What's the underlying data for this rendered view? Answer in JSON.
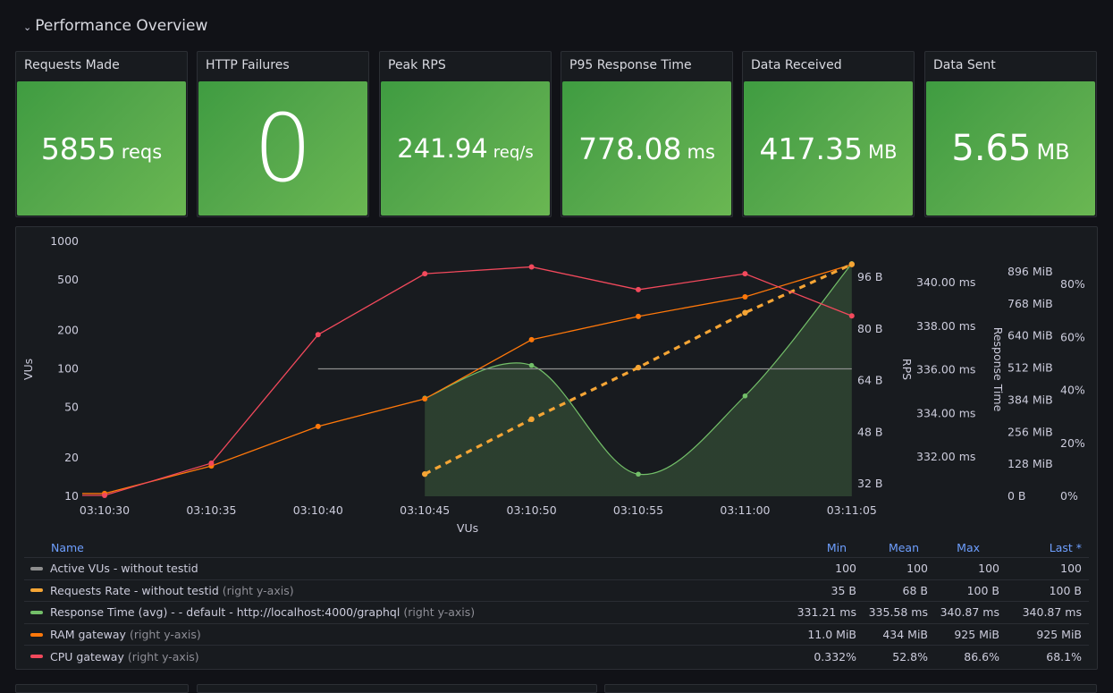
{
  "row": {
    "title": "Performance Overview",
    "collapse_icon": "chevron-down-icon"
  },
  "stats": [
    {
      "title": "Requests Made",
      "value": "5855",
      "unit": "reqs"
    },
    {
      "title": "HTTP Failures",
      "value": "0",
      "unit": ""
    },
    {
      "title": "Peak RPS",
      "value": "241.94",
      "unit": "req/s"
    },
    {
      "title": "P95 Response Time",
      "value": "778.08",
      "unit": "ms"
    },
    {
      "title": "Data Received",
      "value": "417.35",
      "unit": "MB"
    },
    {
      "title": "Data Sent",
      "value": "5.65",
      "unit": "MB"
    }
  ],
  "colors": {
    "stat_green": "#56a84c",
    "vus": "#8e8e8e",
    "requests_rate": "#f5a535",
    "response_time": "#73bf69",
    "ram": "#ff780a",
    "cpu": "#f2495c",
    "legend_header": "#6e9fff"
  },
  "chart_data": {
    "type": "line",
    "x": [
      "03:10:30",
      "03:10:35",
      "03:10:40",
      "03:10:45",
      "03:10:50",
      "03:10:55",
      "03:11:00",
      "03:11:05"
    ],
    "xlabel": "VUs",
    "axes": {
      "left": {
        "label": "VUs",
        "scale": "log",
        "ticks": [
          "1000",
          "500",
          "200",
          "100",
          "50",
          "20",
          "10"
        ],
        "tick_values": [
          1000,
          500,
          200,
          100,
          50,
          20,
          10
        ],
        "range": [
          10,
          1000
        ]
      },
      "rps": {
        "label": "RPS",
        "ticks": [
          "96 B",
          "80 B",
          "64 B",
          "48 B",
          "32 B"
        ],
        "tick_values": [
          96,
          80,
          64,
          48,
          32
        ],
        "range": [
          29.5,
          101
        ]
      },
      "response": {
        "label": "Response Time",
        "ticks": [
          "340.00 ms",
          "338.00 ms",
          "336.00 ms",
          "334.00 ms",
          "332.00 ms"
        ],
        "tick_values": [
          340,
          338,
          336,
          334,
          332
        ],
        "range": [
          330.2,
          341.2
        ]
      },
      "ram": {
        "label": "",
        "ticks": [
          "896 MiB",
          "768 MiB",
          "640 MiB",
          "512 MiB",
          "384 MiB",
          "256 MiB",
          "128 MiB",
          "0 B"
        ],
        "tick_values": [
          896,
          768,
          640,
          512,
          384,
          256,
          128,
          0
        ],
        "range": [
          0,
          940
        ]
      },
      "cpu": {
        "label": "",
        "ticks": [
          "80%",
          "60%",
          "40%",
          "20%",
          "0%"
        ],
        "tick_values": [
          80,
          60,
          40,
          20,
          0
        ],
        "range": [
          0,
          88
        ]
      }
    },
    "series": [
      {
        "name": "Active VUs - without testid",
        "axis": "left",
        "style": "line",
        "values": [
          null,
          null,
          100,
          100,
          100,
          100,
          100,
          100
        ]
      },
      {
        "name": "Requests Rate - without testid",
        "axis": "rps",
        "style": "dashed",
        "values": [
          null,
          null,
          null,
          35,
          52,
          68,
          85,
          100
        ]
      },
      {
        "name": "Response Time (avg) - - default - http://localhost:4000/graphql",
        "axis": "response",
        "style": "area-smooth",
        "values": [
          null,
          null,
          null,
          334.7,
          336.2,
          331.21,
          334.8,
          340.87
        ]
      },
      {
        "name": "RAM gateway",
        "axis": "ram",
        "style": "line-points",
        "values": [
          11,
          121,
          279,
          389,
          625,
          718,
          796,
          925
        ]
      },
      {
        "name": "CPU gateway",
        "axis": "cpu",
        "style": "line-points",
        "values": [
          0.332,
          12.5,
          61,
          84,
          86.6,
          78,
          84,
          68.1
        ]
      }
    ]
  },
  "legend": {
    "headers": {
      "name": "Name",
      "min": "Min",
      "mean": "Mean",
      "max": "Max",
      "last": "Last *"
    },
    "rows": [
      {
        "name": "Active VUs - without testid",
        "axis_note": "",
        "color": "#8e8e8e",
        "min": "100",
        "mean": "100",
        "max": "100",
        "last": "100"
      },
      {
        "name": "Requests Rate - without testid",
        "axis_note": "(right y-axis)",
        "color": "#f5a535",
        "min": "35 B",
        "mean": "68 B",
        "max": "100 B",
        "last": "100 B"
      },
      {
        "name": "Response Time (avg) - - default - http://localhost:4000/graphql",
        "axis_note": "(right y-axis)",
        "color": "#73bf69",
        "min": "331.21 ms",
        "mean": "335.58 ms",
        "max": "340.87 ms",
        "last": "340.87 ms"
      },
      {
        "name": "RAM gateway",
        "axis_note": "(right y-axis)",
        "color": "#ff780a",
        "min": "11.0 MiB",
        "mean": "434 MiB",
        "max": "925 MiB",
        "last": "925 MiB"
      },
      {
        "name": "CPU gateway",
        "axis_note": "(right y-axis)",
        "color": "#f2495c",
        "min": "0.332%",
        "mean": "52.8%",
        "max": "86.6%",
        "last": "68.1%"
      }
    ]
  }
}
